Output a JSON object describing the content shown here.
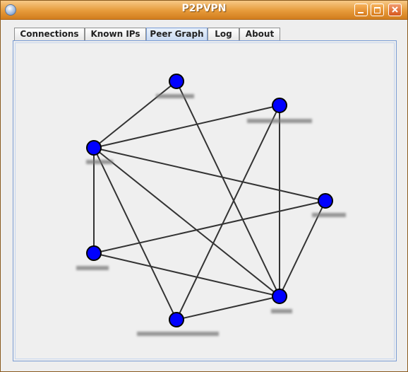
{
  "window": {
    "title": "P2PVPN"
  },
  "tabs": [
    {
      "label": "Connections",
      "selected": false
    },
    {
      "label": "Known IPs",
      "selected": false
    },
    {
      "label": "Peer Graph",
      "selected": true
    },
    {
      "label": "Log",
      "selected": false
    },
    {
      "label": "About",
      "selected": false
    }
  ],
  "colors": {
    "node": "#0000ff",
    "edge": "#333333",
    "accent": "#e69a3a"
  },
  "graph": {
    "nodes": [
      "n1",
      "n2",
      "n3",
      "n4",
      "n5",
      "n6",
      "n7"
    ],
    "edges": [
      [
        0,
        2
      ],
      [
        0,
        6
      ],
      [
        1,
        2
      ],
      [
        1,
        5
      ],
      [
        1,
        6
      ],
      [
        2,
        3
      ],
      [
        2,
        4
      ],
      [
        2,
        5
      ],
      [
        2,
        6
      ],
      [
        3,
        4
      ],
      [
        3,
        6
      ],
      [
        4,
        6
      ],
      [
        5,
        6
      ]
    ]
  }
}
